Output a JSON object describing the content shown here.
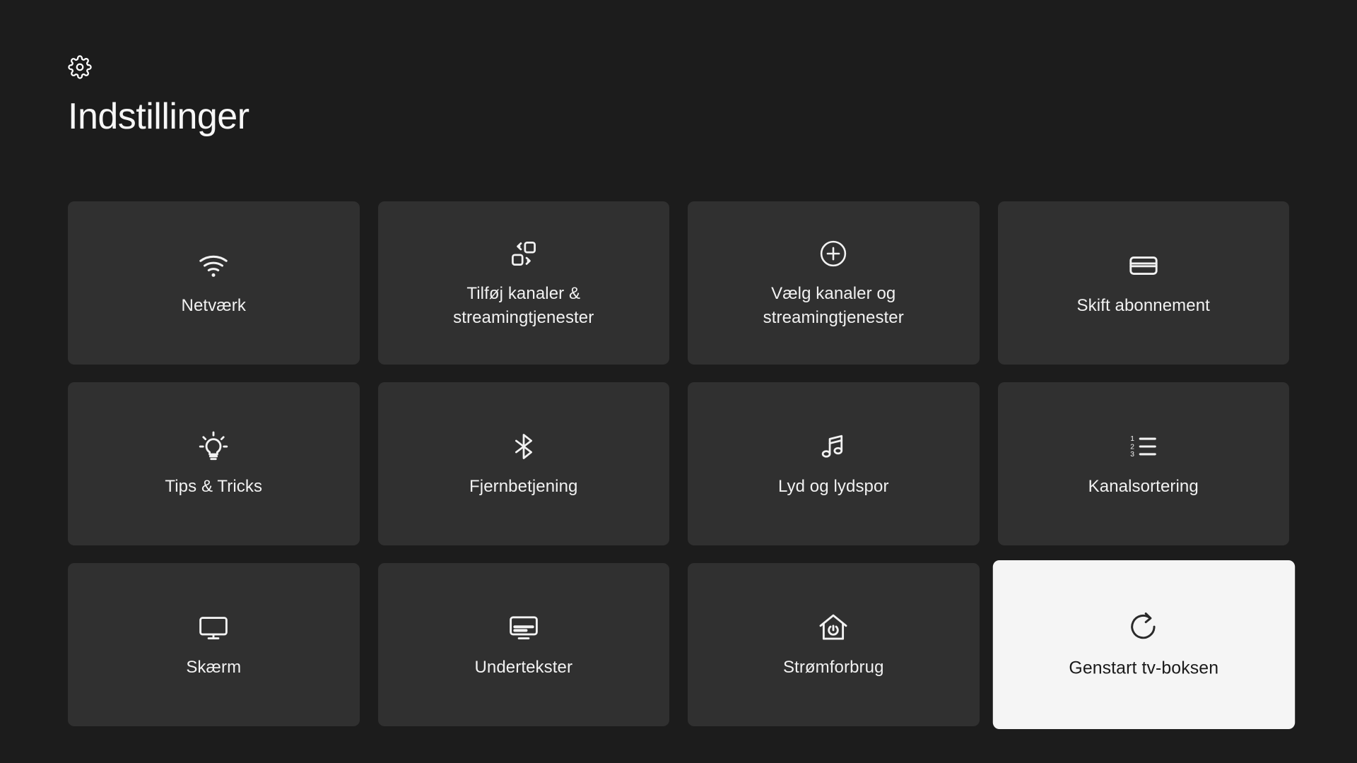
{
  "header": {
    "icon": "gear-icon",
    "title": "Indstillinger"
  },
  "grid": {
    "columns": 4,
    "rows": 3,
    "cards": [
      {
        "id": "netvaerk",
        "label": "Netværk",
        "icon": "wifi-icon",
        "selected": false
      },
      {
        "id": "tilfoj-kanaler",
        "label": "Tilføj kanaler & streamingtjenester",
        "icon": "transfer-icon",
        "selected": false
      },
      {
        "id": "vaelg-kanaler",
        "label": "Vælg kanaler og streamingtjenester",
        "icon": "plus-circle-icon",
        "selected": false
      },
      {
        "id": "skift-abonnement",
        "label": "Skift abonnement",
        "icon": "credit-card-icon",
        "selected": false
      },
      {
        "id": "tips-tricks",
        "label": "Tips & Tricks",
        "icon": "lightbulb-icon",
        "selected": false
      },
      {
        "id": "fjernbetjening",
        "label": "Fjernbetjening",
        "icon": "bluetooth-icon",
        "selected": false
      },
      {
        "id": "lyd-lydspor",
        "label": "Lyd og lydspor",
        "icon": "music-note-icon",
        "selected": false
      },
      {
        "id": "kanalsortering",
        "label": "Kanalsortering",
        "icon": "ordered-list-icon",
        "selected": false
      },
      {
        "id": "skaerm",
        "label": "Skærm",
        "icon": "monitor-icon",
        "selected": false
      },
      {
        "id": "undertekster",
        "label": "Undertekster",
        "icon": "subtitles-icon",
        "selected": false
      },
      {
        "id": "stromforbrug",
        "label": "Strømforbrug",
        "icon": "house-power-icon",
        "selected": false
      },
      {
        "id": "genstart-tv-boks",
        "label": "Genstart tv-boksen",
        "icon": "restart-icon",
        "selected": true
      }
    ]
  },
  "colors": {
    "background": "#1c1c1c",
    "card": "#303030",
    "card_selected": "#f5f5f5",
    "text": "#f2f2f2",
    "text_selected": "#1a1a1a"
  }
}
